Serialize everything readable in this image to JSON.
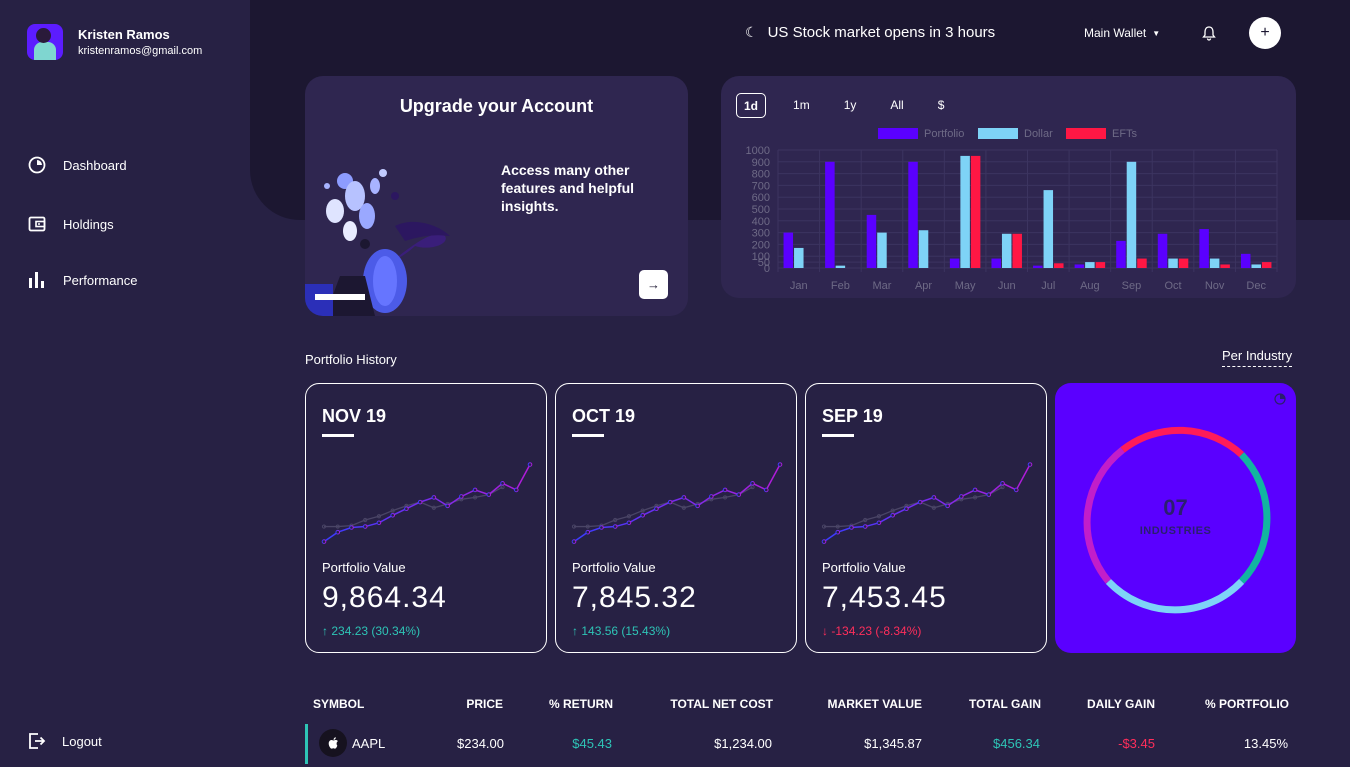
{
  "user": {
    "name": "Kristen Ramos",
    "email": "kristenramos@gmail.com"
  },
  "nav": {
    "items": [
      {
        "label": "Dashboard",
        "icon": "pie-chart-icon"
      },
      {
        "label": "Holdings",
        "icon": "wallet-icon"
      },
      {
        "label": "Performance",
        "icon": "bar-chart-icon"
      }
    ],
    "logout": "Logout"
  },
  "header": {
    "market_status": "US Stock market opens in 3 hours",
    "wallet": "Main Wallet"
  },
  "upgrade": {
    "title": "Upgrade your Account",
    "text": "Access many other features and helpful insights."
  },
  "chart_tabs": [
    "1d",
    "1m",
    "1y",
    "All",
    "$"
  ],
  "chart_data": {
    "type": "bar",
    "categories": [
      "Jan",
      "Feb",
      "Mar",
      "Apr",
      "May",
      "Jun",
      "Jul",
      "Aug",
      "Sep",
      "Oct",
      "Nov",
      "Dec"
    ],
    "series": [
      {
        "name": "Portfolio",
        "color": "#5a00ff",
        "values": [
          300,
          900,
          450,
          900,
          80,
          80,
          20,
          30,
          230,
          290,
          330,
          120
        ]
      },
      {
        "name": "Dollar",
        "color": "#7ed3f7",
        "values": [
          170,
          20,
          300,
          320,
          950,
          290,
          660,
          50,
          900,
          80,
          80,
          30
        ]
      },
      {
        "name": "EFTs",
        "color": "#ff1744",
        "values": [
          0,
          0,
          0,
          0,
          950,
          290,
          40,
          50,
          80,
          80,
          30,
          50
        ]
      }
    ],
    "yticks": [
      0,
      50,
      100,
      200,
      300,
      400,
      500,
      600,
      700,
      800,
      900,
      1000
    ],
    "ylim": [
      0,
      1000
    ],
    "legend": "top"
  },
  "portfolio": {
    "title": "Portfolio History",
    "per_industry": "Per Industry",
    "value_label": "Portfolio Value",
    "cards": [
      {
        "date": "NOV 19",
        "value": "9,864.34",
        "change": "234.23 (30.34%)",
        "direction": "up"
      },
      {
        "date": "OCT 19",
        "value": "7,845.32",
        "change": "143.56 (15.43%)",
        "direction": "up"
      },
      {
        "date": "SEP 19",
        "value": "7,453.45",
        "change": "-134.23 (-8.34%)",
        "direction": "down"
      }
    ],
    "spark_primary": [
      10,
      20,
      25,
      26,
      30,
      38,
      45,
      52,
      57,
      48,
      58,
      65,
      60,
      72,
      65,
      92
    ],
    "spark_secondary": [
      26,
      26,
      27,
      33,
      37,
      43,
      48,
      52,
      46,
      50,
      55,
      57,
      60,
      68
    ]
  },
  "industries": {
    "count": "07",
    "label": "INDUSTRIES"
  },
  "table": {
    "headers": [
      "SYMBOL",
      "PRICE",
      "% RETURN",
      "TOTAL NET COST",
      "MARKET VALUE",
      "TOTAL GAIN",
      "DAILY GAIN",
      "% PORTFOLIO"
    ],
    "rows": [
      {
        "symbol": "AAPL",
        "price": "$234.00",
        "return": "$45.43",
        "net_cost": "$1,234.00",
        "market_value": "$1,345.87",
        "total_gain": "$456.34",
        "daily_gain": "-$3.45",
        "portfolio": "13.45%"
      }
    ]
  }
}
